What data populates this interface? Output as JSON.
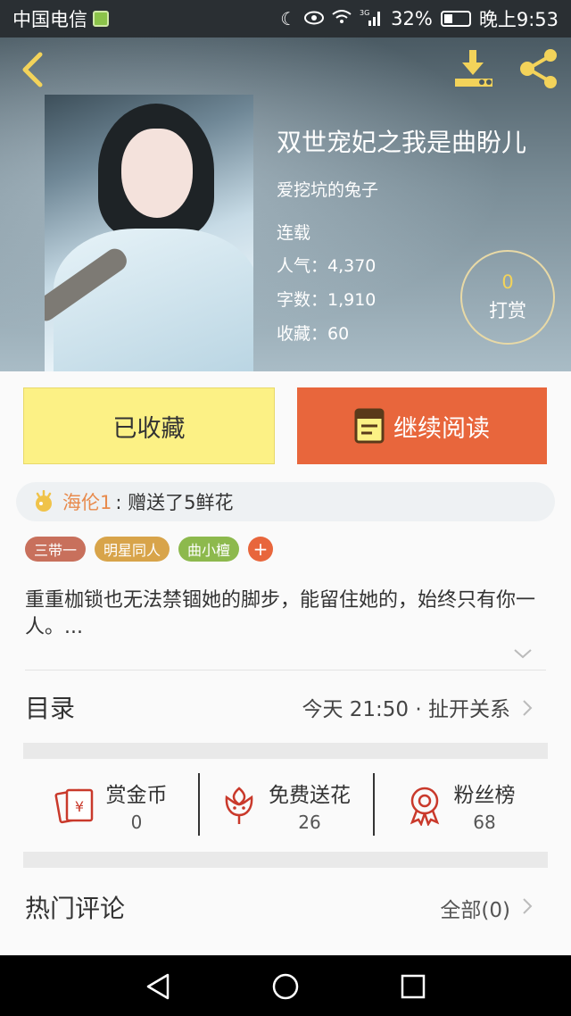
{
  "status_bar": {
    "carrier": "中国电信",
    "network": "3G",
    "battery": "32%",
    "time": "晚上9:53",
    "icons": [
      "moon-icon",
      "eye-icon",
      "wifi-icon",
      "signal-icon",
      "battery-icon"
    ]
  },
  "book": {
    "title": "双世宠妃之我是曲盼儿",
    "author": "爱挖坑的兔子",
    "status": "连载",
    "popularity": "人气：4,370",
    "word_count": "字数：1,910",
    "favorites": "收藏：60"
  },
  "reward": {
    "count": "0",
    "label": "打赏"
  },
  "actions": {
    "favorited_label": "已收藏",
    "continue_label": "继续阅读"
  },
  "gift_banner": {
    "user": "海伦1",
    "message": ": 赠送了5鲜花"
  },
  "tags": [
    {
      "label": "三带一",
      "color": "#c8705c"
    },
    {
      "label": "明星同人",
      "color": "#d8a44a"
    },
    {
      "label": "曲小檀",
      "color": "#8db94d"
    }
  ],
  "tag_add_label": "+",
  "synopsis": "重重枷锁也无法禁锢她的脚步，能留住她的，始终只有你一人。...",
  "toc": {
    "label": "目录",
    "latest": "今天 21:50 · 扯开关系"
  },
  "stats": {
    "coins": {
      "label": "赏金币",
      "value": "0"
    },
    "flowers": {
      "label": "免费送花",
      "value": "26"
    },
    "fans": {
      "label": "粉丝榜",
      "value": "68"
    }
  },
  "comments": {
    "label": "热门评论",
    "all_label": "全部(0)"
  },
  "colors": {
    "accent": "#e8663c",
    "favorite_bg": "#fcf185",
    "gold": "#f3d35a"
  }
}
